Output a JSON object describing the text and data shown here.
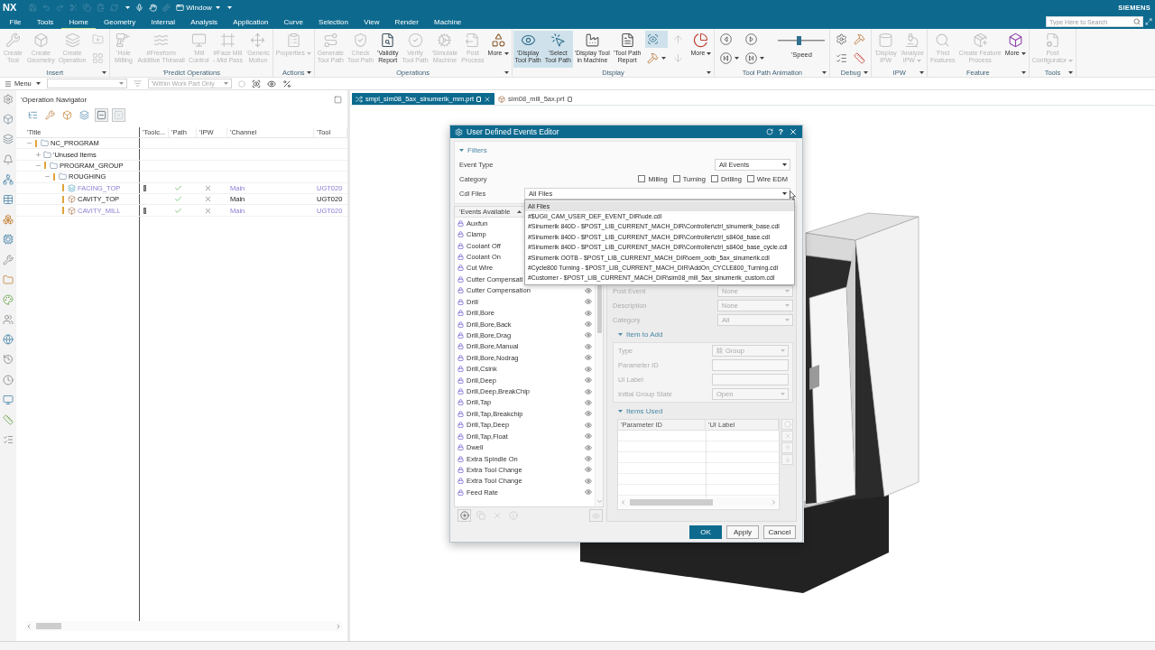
{
  "title_bar": {
    "logo": "NX",
    "window_menu": "Window",
    "brand": "SIEMENS"
  },
  "menu_tabs": [
    {
      "label": "File",
      "selected": false
    },
    {
      "label": "Tools",
      "selected": false
    },
    {
      "label": "Home",
      "selected": true
    },
    {
      "label": "Geometry",
      "selected": false
    },
    {
      "label": "Internal",
      "selected": false
    },
    {
      "label": "Analysis",
      "selected": false
    },
    {
      "label": "Application",
      "selected": false
    },
    {
      "label": "Curve",
      "selected": false
    },
    {
      "label": "Selection",
      "selected": false
    },
    {
      "label": "View",
      "selected": false
    },
    {
      "label": "Render",
      "selected": false
    },
    {
      "label": "Machine",
      "selected": false
    }
  ],
  "search": {
    "placeholder": "Type Here to Search"
  },
  "ribbon": [
    {
      "label": "Insert",
      "menu": true,
      "items": [
        {
          "kind": "large",
          "label": "Create\nTool",
          "disabled": true
        },
        {
          "kind": "large",
          "label": "Create\nGeometry",
          "disabled": true
        },
        {
          "kind": "large",
          "label": "Create\nOperation",
          "disabled": true
        },
        {
          "kind": "small",
          "disabled": true
        },
        {
          "kind": "small",
          "disabled": true
        }
      ]
    },
    {
      "label": "'Predict Operations",
      "menu": false,
      "items": [
        {
          "kind": "large",
          "label": "'Hole\nMilling",
          "disabled": true
        },
        {
          "kind": "large",
          "label": "#Freeform\nAdditive Thinwall",
          "disabled": true
        },
        {
          "kind": "large",
          "label": "'Mill\nControl",
          "disabled": true
        },
        {
          "kind": "large",
          "label": "#Face Mill\n- Mid Pass",
          "disabled": true
        },
        {
          "kind": "large",
          "label": "'Generic\nMotion",
          "disabled": true
        }
      ]
    },
    {
      "label": "Actions",
      "menu": true,
      "items": [
        {
          "kind": "large",
          "label": "Properties",
          "disabled": true,
          "dropdown": true
        }
      ]
    },
    {
      "label": "Operations",
      "menu": true,
      "items": [
        {
          "kind": "large",
          "label": "Generate\nTool Path",
          "disabled": true
        },
        {
          "kind": "large",
          "label": "Check\nTool Path",
          "disabled": true
        },
        {
          "kind": "large",
          "label": "'Validity\nReport",
          "disabled": false
        },
        {
          "kind": "large",
          "label": "Verify\nTool Path",
          "disabled": true
        },
        {
          "kind": "large",
          "label": "'Simulate\nMachine",
          "disabled": true
        },
        {
          "kind": "large",
          "label": "Post\nProcess",
          "disabled": true
        },
        {
          "kind": "large",
          "label": "More",
          "disabled": false,
          "dropdown": true
        }
      ]
    },
    {
      "label": "Display",
      "menu": true,
      "items": [
        {
          "kind": "large",
          "label": "'Display\nTool Path",
          "disabled": false,
          "selected": true
        },
        {
          "kind": "large",
          "label": "'Select\nTool Path",
          "disabled": false,
          "selected": true
        },
        {
          "kind": "large",
          "label": "'Display Tool\nin Machine",
          "disabled": false,
          "selected": false
        },
        {
          "kind": "large",
          "label": "'Tool Path\nReport",
          "disabled": false,
          "selected": false
        },
        {
          "kind": "small",
          "disabled": false,
          "selected": true
        },
        {
          "kind": "small",
          "disabled": false,
          "selected": false,
          "dropdown": true
        },
        {
          "kind": "small",
          "disabled": true,
          "selected": false
        },
        {
          "kind": "small",
          "disabled": true,
          "selected": false
        },
        {
          "kind": "large",
          "label": "More",
          "disabled": false,
          "selected": false,
          "dropdown": true
        }
      ]
    },
    {
      "label": "Tool Path Animation",
      "menu": true,
      "items": [
        {
          "kind": "small",
          "disabled": false
        },
        {
          "kind": "small",
          "disabled": false,
          "dropdown": true
        },
        {
          "kind": "small",
          "disabled": false
        },
        {
          "kind": "small",
          "disabled": false,
          "dropdown": true
        },
        {
          "kind": "slider",
          "label": "'Speed",
          "level": 0.45
        }
      ]
    },
    {
      "label": "Debug",
      "menu": true,
      "items": [
        {
          "kind": "small",
          "disabled": false
        },
        {
          "kind": "small",
          "disabled": false
        },
        {
          "kind": "small",
          "disabled": false
        },
        {
          "kind": "small",
          "disabled": false
        }
      ]
    },
    {
      "label": "IPW",
      "menu": true,
      "items": [
        {
          "kind": "large",
          "label": "'Display\nIPW",
          "disabled": true
        },
        {
          "kind": "large",
          "label": "'Analyze\nIPW",
          "disabled": true,
          "dropdown": true
        }
      ]
    },
    {
      "label": "Feature",
      "menu": true,
      "items": [
        {
          "kind": "large",
          "label": "'Find\nFeatures",
          "disabled": true
        },
        {
          "kind": "large",
          "label": "Create Feature\nProcess",
          "disabled": true
        },
        {
          "kind": "large",
          "label": "More",
          "disabled": false,
          "dropdown": true
        }
      ]
    },
    {
      "label": "Tools",
      "menu": true,
      "items": [
        {
          "kind": "large",
          "label": "Post\nConfigurator",
          "disabled": true,
          "dropdown": true
        }
      ]
    }
  ],
  "selection_bar": {
    "menu": "Menu",
    "scope": "'Within Work Part Only"
  },
  "navigator": {
    "title": "'Operation Navigator",
    "toolbar": [
      {
        "disabled": false
      },
      {
        "disabled": false
      },
      {
        "disabled": false
      },
      {
        "disabled": false
      },
      {
        "disabled": false
      },
      {
        "disabled": true
      }
    ],
    "columns": [
      "'Title",
      "'Toolc...",
      "'Path",
      "'IPW",
      "'Channel",
      "'Tool"
    ],
    "tree": [
      {
        "kind": "group",
        "name": "NC_PROGRAM",
        "expanded": true,
        "flagged": true,
        "children": [
          {
            "kind": "group",
            "name": "'Unused Items",
            "expanded": false,
            "flagged": false
          },
          {
            "kind": "group",
            "name": "PROGRAM_GROUP",
            "expanded": true,
            "flagged": true,
            "children": [
              {
                "kind": "group",
                "name": "ROUGHING",
                "expanded": true,
                "flagged": true,
                "children": [
                  {
                    "kind": "facing",
                    "name": "FACING_TOP",
                    "flagged": true,
                    "active": false,
                    "tool_change": true,
                    "path": true,
                    "ipw": false,
                    "channel": "Main",
                    "tool": "UGT020"
                  },
                  {
                    "kind": "cavity",
                    "name": "CAVITY_TOP",
                    "flagged": true,
                    "active": true,
                    "tool_change": false,
                    "path": true,
                    "ipw": false,
                    "channel": "Main",
                    "tool": "UGT020"
                  },
                  {
                    "kind": "cavity",
                    "name": "CAVITY_MILL",
                    "flagged": true,
                    "active": false,
                    "tool_change": true,
                    "path": true,
                    "ipw": false,
                    "channel": "Main",
                    "tool": "UGT020"
                  }
                ]
              }
            ]
          }
        ]
      }
    ]
  },
  "document_tabs": [
    {
      "label": "smpl_sim08_5ax_sinumerik_mm.prt",
      "selected": true
    },
    {
      "label": "sim08_mill_5ax.prt",
      "selected": false
    }
  ],
  "dialog": {
    "title": "User Defined Events Editor",
    "help": "?",
    "filters": {
      "title": "Filters",
      "expanded": true,
      "event_type": {
        "label": "Event Type",
        "value": "All Events"
      },
      "category": {
        "label": "Category",
        "options": [
          {
            "label": "Milling",
            "checked": false
          },
          {
            "label": "Turning",
            "checked": false
          },
          {
            "label": "Drilling",
            "checked": false
          },
          {
            "label": "Wire EDM",
            "checked": false
          }
        ]
      },
      "cdl_files": {
        "label": "Cdl Files",
        "value": "All Files",
        "expanded": true,
        "options": [
          {
            "label": "All Files",
            "selected": true
          },
          {
            "label": "#$UGII_CAM_USER_DEF_EVENT_DIR\\ude.cdl",
            "selected": false
          },
          {
            "label": "#Sinumerik 840D - $POST_LIB_CURRENT_MACH_DIR\\Controller\\ctrl_sinumerik_base.cdl",
            "selected": false
          },
          {
            "label": "#Sinumerik 840D - $POST_LIB_CURRENT_MACH_DIR\\Controller\\ctrl_s840d_base.cdl",
            "selected": false
          },
          {
            "label": "#Sinumerik 840D - $POST_LIB_CURRENT_MACH_DIR\\Controller\\ctrl_s840d_base_cycle.cdl",
            "selected": false
          },
          {
            "label": "#Sinumerik OOTB - $POST_LIB_CURRENT_MACH_DIR\\oem_ootb_5ax_sinumerik.cdl",
            "selected": false
          },
          {
            "label": "#Cycle800 Turning - $POST_LIB_CURRENT_MACH_DIR\\AddOn_CYCLE800_Turning.cdl",
            "selected": false
          },
          {
            "label": "#Customer - $POST_LIB_CURRENT_MACH_DIR\\sim08_mill_5ax_sinumerik_custom.cdl",
            "selected": false
          }
        ]
      }
    },
    "events": {
      "title": "'Events Available",
      "items": [
        {
          "label": "Auxfun"
        },
        {
          "label": "Clamp"
        },
        {
          "label": "Coolant Off"
        },
        {
          "label": "Coolant On"
        },
        {
          "label": "Cut Wire"
        },
        {
          "label": "Cutter Compensati"
        },
        {
          "label": "Cutter Compensation",
          "eye": true
        },
        {
          "label": "Drill",
          "eye": true
        },
        {
          "label": "Drill,Bore",
          "eye": true
        },
        {
          "label": "Drill,Bore,Back",
          "eye": true
        },
        {
          "label": "Drill,Bore,Drag",
          "eye": true
        },
        {
          "label": "Drill,Bore,Manual",
          "eye": true
        },
        {
          "label": "Drill,Bore,Nodrag",
          "eye": true
        },
        {
          "label": "Drill,Csink",
          "eye": true
        },
        {
          "label": "Drill,Deep",
          "eye": true
        },
        {
          "label": "Drill,Deep,BreakChip",
          "eye": true
        },
        {
          "label": "Drill,Tap",
          "eye": true
        },
        {
          "label": "Drill,Tap,Breakchip",
          "eye": true
        },
        {
          "label": "Drill,Tap,Deep",
          "eye": true
        },
        {
          "label": "Drill,Tap,Float",
          "eye": true
        },
        {
          "label": "Dwell",
          "eye": true
        },
        {
          "label": "Extra Spindle On",
          "eye": true
        },
        {
          "label": "Extra Tool Change",
          "eye": true
        },
        {
          "label": "Extra Tool Change",
          "eye": true
        },
        {
          "label": "Feed Rate",
          "eye": true
        }
      ],
      "tools": [
        {
          "disabled": false
        },
        {
          "disabled": true
        },
        {
          "disabled": true
        },
        {
          "disabled": true
        }
      ],
      "view_toggle": {
        "disabled": true
      }
    },
    "event_fields": [
      {
        "label": "Post Event",
        "value": "None",
        "disabled": true
      },
      {
        "label": "Description",
        "value": "None",
        "disabled": true
      },
      {
        "label": "Category",
        "value": "All",
        "disabled": true
      }
    ],
    "item_to_add": {
      "title": "Item to Add",
      "expanded": true,
      "fields": [
        {
          "kind": "picker",
          "label": "Type",
          "value": "Group",
          "disabled": true
        },
        {
          "kind": "text",
          "label": "Parameter ID",
          "disabled": true
        },
        {
          "kind": "text",
          "label": "UI Label",
          "disabled": true
        },
        {
          "kind": "dropdown",
          "label": "Initial Group State",
          "value": "Open",
          "disabled": true
        }
      ]
    },
    "items_used": {
      "title": "Items Used",
      "expanded": true,
      "columns": [
        "'Parameter ID",
        "'UI Label"
      ],
      "tools": [
        {
          "disabled": true
        },
        {
          "disabled": true
        },
        {
          "disabled": true
        },
        {
          "disabled": true
        }
      ]
    },
    "buttons": [
      {
        "label": "OK",
        "kind": "primary"
      },
      {
        "label": "Apply",
        "kind": "secondary"
      },
      {
        "label": "Cancel",
        "kind": "secondary"
      }
    ]
  }
}
